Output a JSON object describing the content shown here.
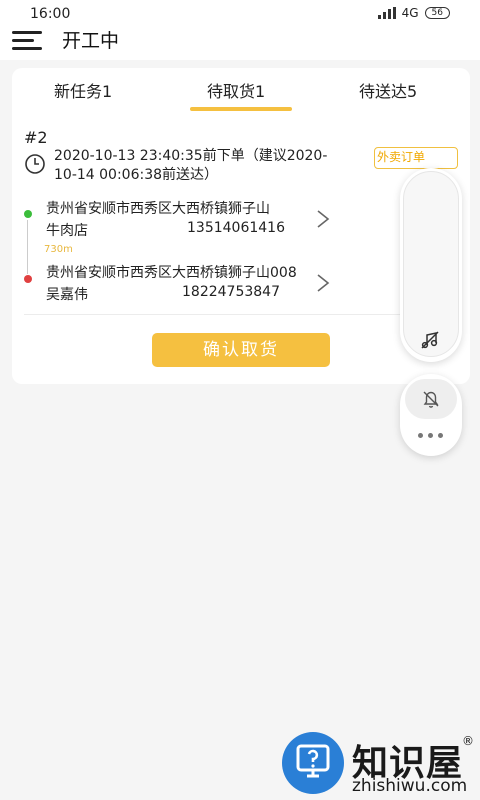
{
  "status_bar": {
    "time": "16:00",
    "network": "4G",
    "battery": "56"
  },
  "header": {
    "title": "开工中",
    "menu_icon": "hamburger-menu-icon"
  },
  "tabs": [
    {
      "label": "新任务1",
      "active": false
    },
    {
      "label": "待取货1",
      "active": true
    },
    {
      "label": "待送达5",
      "active": false
    }
  ],
  "order": {
    "number": "#2",
    "time_line1": "2020-10-13 23:40:35前下单（建议2020-",
    "time_line2": "10-14 00:06:38前送达）",
    "tag": "外卖订单",
    "pickup": {
      "address": "贵州省安顺市西秀区大西桥镇狮子山",
      "name": "牛肉店",
      "phone": "13514061416"
    },
    "distance": "730m",
    "delivery": {
      "address": "贵州省安顺市西秀区大西桥镇狮子山008",
      "name": "吴嘉伟",
      "phone": "18224753847"
    },
    "confirm_label": "确认取货"
  },
  "float_buttons": [
    "music-off-icon",
    "bell-off-icon",
    "more-icon"
  ],
  "watermark": {
    "brand": "知识屋",
    "registered": "®",
    "domain": "zhishiwu.com"
  },
  "colors": {
    "accent": "#f5c040",
    "pickup_dot": "#3bbd3b",
    "delivery_dot": "#e04040",
    "watermark_blue": "#2a7fd6"
  }
}
